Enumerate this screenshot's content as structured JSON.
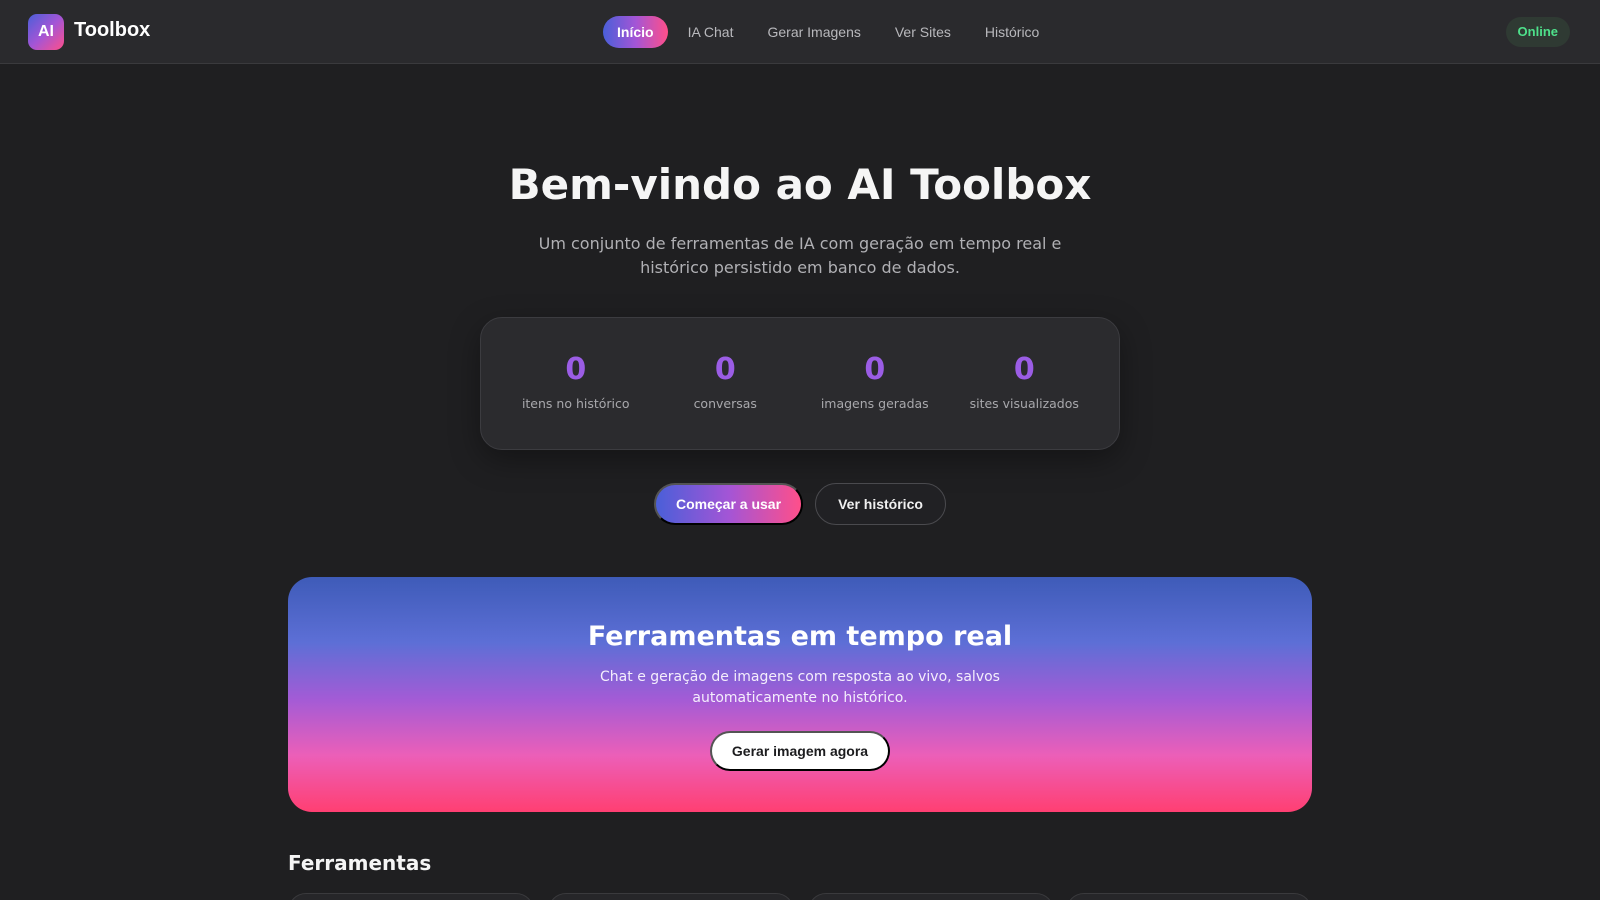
{
  "header": {
    "logo_badge": "AI",
    "logo_text": "Toolbox",
    "nav": [
      {
        "label": "Início",
        "active": true
      },
      {
        "label": "IA Chat",
        "active": false
      },
      {
        "label": "Gerar Imagens",
        "active": false
      },
      {
        "label": "Ver Sites",
        "active": false
      },
      {
        "label": "Histórico",
        "active": false
      }
    ],
    "status": "Online"
  },
  "hero": {
    "title": "Bem-vindo ao AI Toolbox",
    "subtitle": "Um conjunto de ferramentas de IA com geração em tempo real e histórico persistido em banco de dados."
  },
  "stats": [
    {
      "value": "0",
      "label": "itens no histórico"
    },
    {
      "value": "0",
      "label": "conversas"
    },
    {
      "value": "0",
      "label": "imagens geradas"
    },
    {
      "value": "0",
      "label": "sites visualizados"
    }
  ],
  "actions": {
    "primary": "Começar a usar",
    "secondary": "Ver histórico"
  },
  "banner": {
    "title": "Ferramentas em tempo real",
    "subtitle": "Chat e geração de imagens com resposta ao vivo, salvos automaticamente no histórico.",
    "button": "Gerar imagem agora"
  },
  "tools_section": {
    "title": "Ferramentas"
  },
  "colors": {
    "accent_gradient": [
      "#4a5fd8",
      "#a355d6",
      "#ff4f8a"
    ],
    "stat_number": "#9b5de5",
    "status_online": "#4ee08a",
    "background": "#1f1f21"
  }
}
